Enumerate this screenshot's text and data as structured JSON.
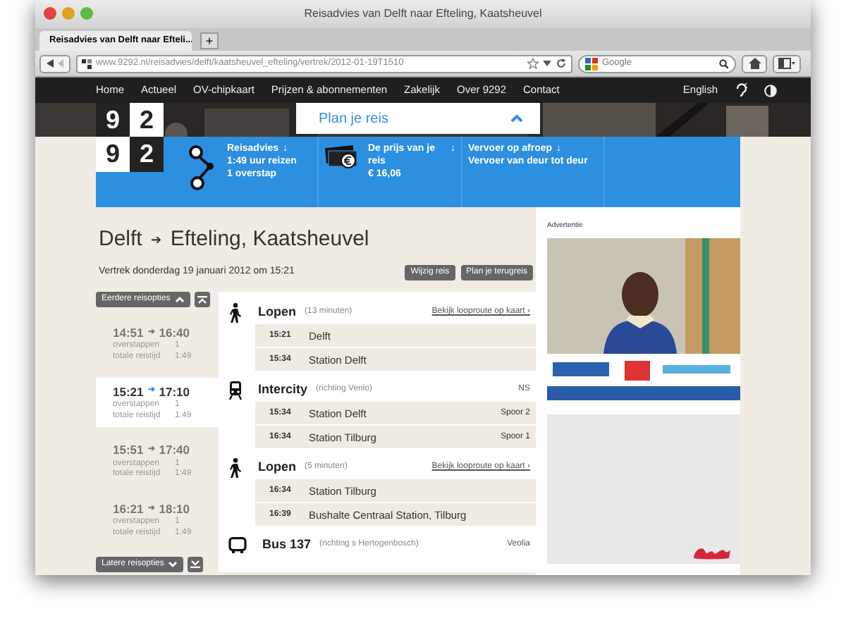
{
  "window": {
    "title": "Reisadvies van Delft naar Efteling, Kaatsheuvel"
  },
  "tabs": [
    {
      "label": "Reisadvies van Delft naar Efteli...",
      "selected": true
    }
  ],
  "new_tab": "+",
  "address": "www.9292.nl/reisadvies/delft/kaatsheuvel_efteling/vertrek/2012-01-19T1510",
  "search": {
    "placeholder": "Google"
  },
  "nav": {
    "items": [
      "Home",
      "Actueel",
      "OV-chipkaart",
      "Prijzen & abonnementen",
      "Zakelijk",
      "Over 9292",
      "Contact"
    ],
    "language": "English"
  },
  "logo": [
    "9",
    "2",
    "9",
    "2"
  ],
  "plan": {
    "label": "Plan je reis",
    "expanded": true
  },
  "summary": [
    {
      "kind": "route",
      "title": "Reisadvies",
      "arrow": "↓",
      "lines": [
        "1:49 uur reizen",
        "1 overstap"
      ]
    },
    {
      "kind": "price",
      "title": "De prijs van je reis",
      "arrow": "↓",
      "lines": [
        "€ 16,06"
      ]
    },
    {
      "kind": "service",
      "title": "Vervoer op afroep",
      "arrow": "↓",
      "lines": [
        "Vervoer van deur tot deur"
      ]
    }
  ],
  "journey": {
    "from": "Delft",
    "arrow": "➔",
    "to": "Efteling, Kaatsheuvel",
    "departure": "Vertrek donderdag 19 januari 2012 om 15:21",
    "buttons": [
      "Wijzig reis",
      "Plan je terugreis"
    ]
  },
  "options": {
    "earlier": "Eerdere reisopties",
    "later": "Latere reisopties",
    "items": [
      {
        "depart": "14:51",
        "arrow": "➔",
        "arrive": "16:40",
        "transfers_label": "overstappen",
        "transfers": "1",
        "duration_label": "totale reistijd",
        "duration": "1:49",
        "selected": false
      },
      {
        "depart": "15:21",
        "arrow": "➔",
        "arrive": "17:10",
        "transfers_label": "overstappen",
        "transfers": "1",
        "duration_label": "totale reistijd",
        "duration": "1:49",
        "selected": true
      },
      {
        "depart": "15:51",
        "arrow": "➔",
        "arrive": "17:40",
        "transfers_label": "overstappen",
        "transfers": "1",
        "duration_label": "totale reistijd",
        "duration": "1:49",
        "selected": false
      },
      {
        "depart": "16:21",
        "arrow": "➔",
        "arrive": "18:10",
        "transfers_label": "overstappen",
        "transfers": "1",
        "duration_label": "totale reistijd",
        "duration": "1:49",
        "selected": false
      }
    ]
  },
  "legs": [
    {
      "kind": "walk",
      "title": "Lopen",
      "detail": "(13 minuten)",
      "link": "Bekijk looproute op kaart ›",
      "stops": [
        {
          "time": "15:21",
          "name": "Delft"
        },
        {
          "time": "15:34",
          "name": "Station Delft"
        }
      ]
    },
    {
      "kind": "train",
      "title": "Intercity",
      "detail": "(richting Venlo)",
      "operator": "NS",
      "stops": [
        {
          "time": "15:34",
          "name": "Station Delft",
          "platform": "Spoor 2"
        },
        {
          "time": "16:34",
          "name": "Station Tilburg",
          "platform": "Spoor 1"
        }
      ]
    },
    {
      "kind": "walk",
      "title": "Lopen",
      "detail": "(5 minuten)",
      "link": "Bekijk looproute op kaart ›",
      "stops": [
        {
          "time": "16:34",
          "name": "Station Tilburg"
        },
        {
          "time": "16:39",
          "name": "Bushalte Centraal Station, Tilburg"
        }
      ]
    },
    {
      "kind": "bus",
      "title": "Bus 137",
      "detail": "(richting s Hertogenbosch)",
      "operator": "Veolia"
    }
  ],
  "ad": {
    "label": "Advertentie"
  }
}
